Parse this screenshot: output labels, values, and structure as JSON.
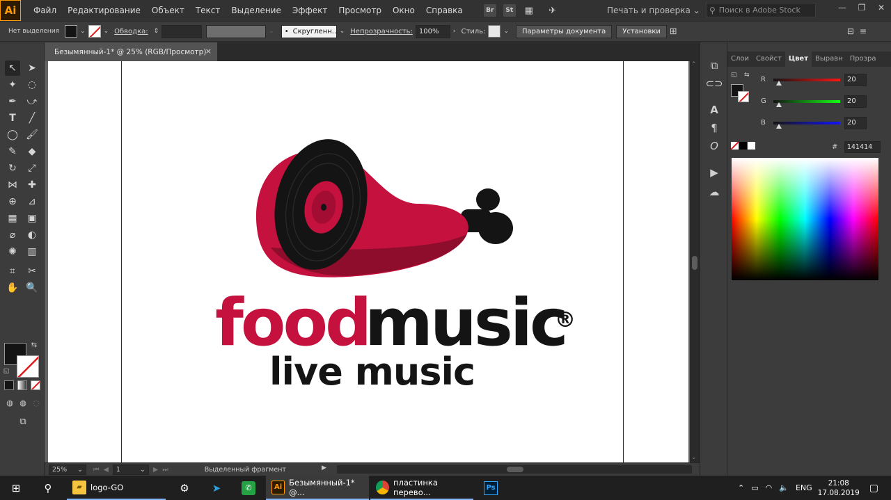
{
  "app": {
    "logo": "Ai",
    "menu": [
      "Файл",
      "Редактирование",
      "Объект",
      "Текст",
      "Выделение",
      "Эффект",
      "Просмотр",
      "Окно",
      "Справка"
    ],
    "bridge_buttons": [
      "Br",
      "St"
    ],
    "workspace": "Печать и проверка",
    "search_placeholder": "Поиск в Adobe Stock"
  },
  "control_bar": {
    "selection_label": "Нет выделения",
    "stroke_label": "Обводка:",
    "brush_label": "Скругленн...",
    "opacity_label": "Непрозрачность:",
    "opacity_value": "100%",
    "style_label": "Стиль:",
    "doc_settings_button": "Параметры документа",
    "preferences_button": "Установки"
  },
  "document": {
    "tab_title": "Безымянный-1* @ 25% (RGB/Просмотр)",
    "close_glyph": "×"
  },
  "artwork": {
    "food_text": "food",
    "music_text": "music",
    "reg_mark": "®",
    "tagline": "live music",
    "colors": {
      "brand_red": "#c4113d",
      "brand_black": "#141414"
    }
  },
  "statusbar": {
    "zoom": "25%",
    "artboard": "1",
    "status_text": "Выделенный фрагмент"
  },
  "color_panel": {
    "tabs": [
      "Слои",
      "Свойст",
      "Цвет",
      "Выравн",
      "Прозра"
    ],
    "active_tab": "Цвет",
    "r_label": "R",
    "r_value": "20",
    "g_label": "G",
    "g_value": "20",
    "b_label": "B",
    "b_value": "20",
    "hex_label": "#",
    "hex_value": "141414"
  },
  "taskbar": {
    "apps": [
      "logo-GO",
      "Безымянный-1* @...",
      "пластинка перево..."
    ],
    "language": "ENG",
    "time": "21:08",
    "date": "17.08.2019"
  }
}
